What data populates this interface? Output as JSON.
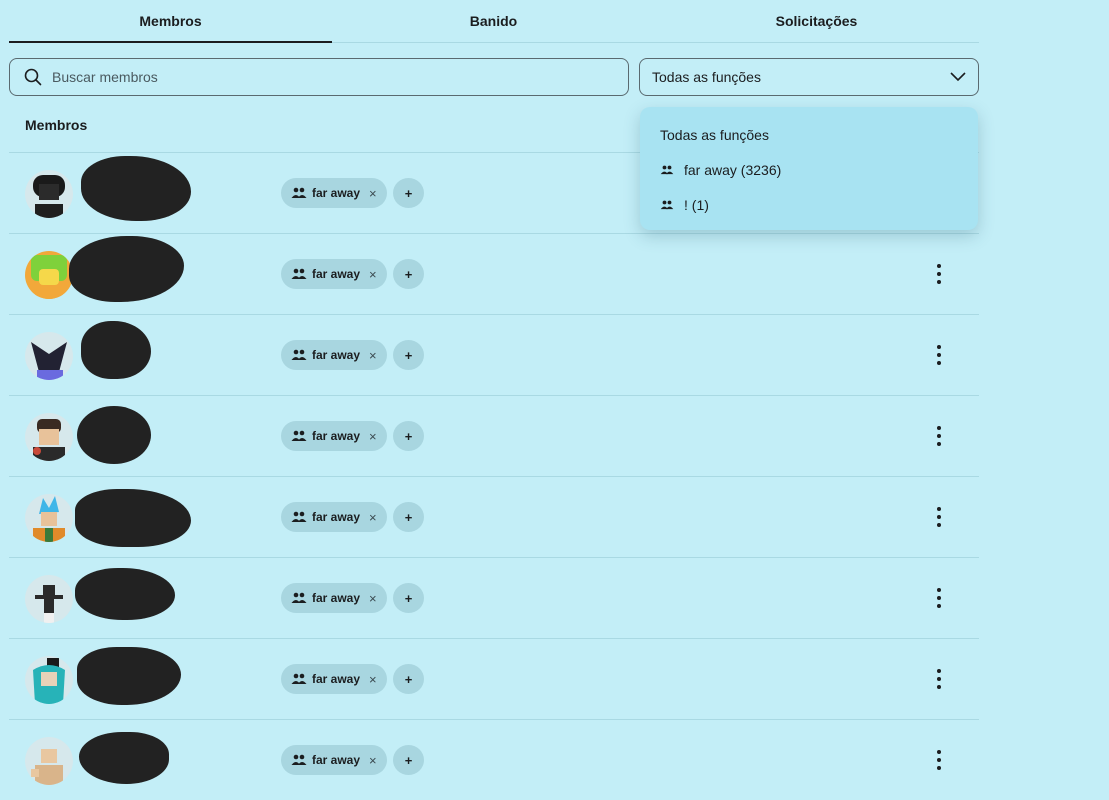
{
  "tabs": [
    {
      "label": "Membros",
      "active": true
    },
    {
      "label": "Banido",
      "active": false
    },
    {
      "label": "Solicitações",
      "active": false
    }
  ],
  "search": {
    "placeholder": "Buscar membros",
    "icon": "search-icon"
  },
  "role_filter": {
    "selected": "Todas as funções",
    "icon": "chevron-down-icon"
  },
  "section_label": "Membros",
  "dropdown": {
    "items": [
      {
        "label": "Todas as funções",
        "icon": ""
      },
      {
        "label": "far away (3236)",
        "icon": "group-icon"
      },
      {
        "label": "! (1)",
        "icon": "group-icon"
      }
    ]
  },
  "members": [
    {
      "role": "far away",
      "avatar_color": "#1a1a1a"
    },
    {
      "role": "far away",
      "avatar_color": "#7fd13b"
    },
    {
      "role": "far away",
      "avatar_color": "#222233"
    },
    {
      "role": "far away",
      "avatar_color": "#3a2a22"
    },
    {
      "role": "far away",
      "avatar_color": "#3fb6e8"
    },
    {
      "role": "far away",
      "avatar_color": "#2a2a2a"
    },
    {
      "role": "far away",
      "avatar_color": "#27b3b8"
    },
    {
      "role": "far away",
      "avatar_color": "#e9c7a0"
    }
  ],
  "add_role_label": "+",
  "remove_role_label": "×"
}
